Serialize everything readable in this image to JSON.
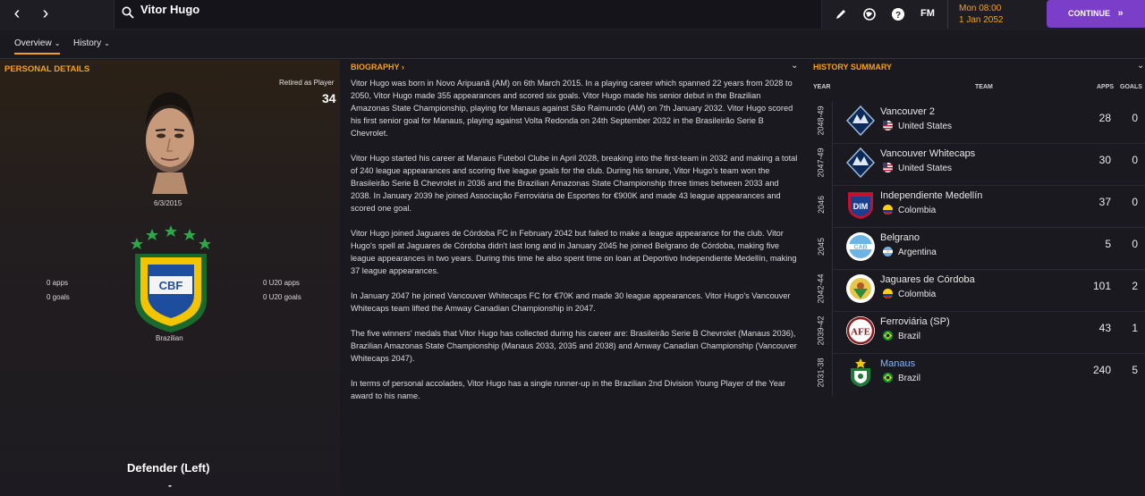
{
  "topbar": {
    "player_name": "Vitor Hugo",
    "time": "Mon 08:00",
    "date": "1 Jan 2052",
    "continue_label": "CONTINUE",
    "fm_label": "FM"
  },
  "tabs": [
    {
      "label": "Overview"
    },
    {
      "label": "History"
    }
  ],
  "personal": {
    "heading": "PERSONAL DETAILS",
    "retired_label": "Retired as Player",
    "retired_age": "34",
    "dob": "6/3/2015",
    "apps": "0 apps",
    "goals": "0 goals",
    "u20_apps": "0 U20 apps",
    "u20_goals": "0 U20 goals",
    "nationality": "Brazilian",
    "badge_text": "CBF",
    "position": "Defender (Left)",
    "position_sub": "-"
  },
  "bio": {
    "heading": "BIOGRAPHY",
    "paragraphs": [
      "Vitor Hugo was born in Novo Aripuanã (AM) on 6th March 2015. In a playing career which spanned 22 years from 2028 to 2050, Vitor Hugo made 355 appearances and scored six goals. Vitor Hugo made his senior debut in the Brazilian Amazonas State Championship, playing for Manaus against São Raimundo (AM) on 7th January 2032. Vitor Hugo scored his first senior goal for Manaus, playing against Volta Redonda on 24th September 2032 in the Brasileirão Serie B Chevrolet.",
      "Vitor Hugo started his career at Manaus Futebol Clube in April 2028, breaking into the first-team in 2032 and making a total of 240 league appearances and scoring five league goals for the club. During his tenure, Vitor Hugo's team won the Brasileirão Serie B Chevrolet in 2036 and the Brazilian Amazonas State Championship three times between 2033 and 2038. In January 2039 he joined Associação Ferroviária de Esportes for €900K and made 43 league appearances and scored one goal.",
      "Vitor Hugo joined Jaguares de Córdoba FC in February 2042 but failed to make a league appearance for the club. Vitor Hugo's spell at Jaguares de Córdoba didn't last long and in January 2045 he joined Belgrano de Córdoba, making five league appearances in two years. During this time he also spent time on loan at Deportivo Independiente Medellín, making 37 league appearances.",
      "In January 2047 he joined Vancouver Whitecaps FC for €70K and made 30 league appearances. Vitor Hugo's Vancouver Whitecaps team lifted the Amway Canadian Championship in 2047.",
      "The five winners' medals that Vitor Hugo has collected during his career are: Brasileirão Serie B Chevrolet (Manaus 2036), Brazilian Amazonas State Championship (Manaus 2033, 2035 and 2038) and Amway Canadian Championship (Vancouver Whitecaps 2047).",
      "In terms of personal accolades, Vitor Hugo has a single runner-up in the Brazilian 2nd Division Young Player of the Year award to his name."
    ]
  },
  "history": {
    "heading": "HISTORY SUMMARY",
    "col_year": "YEAR",
    "col_team": "TEAM",
    "col_apps": "APPS",
    "col_goals": "GOALS",
    "rows": [
      {
        "year": "2048-49",
        "team": "Vancouver 2",
        "nation": "United States",
        "apps": "28",
        "goals": "0",
        "crest": "vancouver",
        "color": "#1c3a6e"
      },
      {
        "year": "2047-49",
        "team": "Vancouver Whitecaps",
        "nation": "United States",
        "apps": "30",
        "goals": "0",
        "crest": "vancouver",
        "color": "#1c3a6e"
      },
      {
        "year": "2046",
        "team": "Independiente Medellín",
        "nation": "Colombia",
        "apps": "37",
        "goals": "0",
        "crest": "medellin",
        "color": "#c8102e"
      },
      {
        "year": "2045",
        "team": "Belgrano",
        "nation": "Argentina",
        "apps": "5",
        "goals": "0",
        "crest": "belgrano",
        "color": "#6cb4e4"
      },
      {
        "year": "2042-44",
        "team": "Jaguares de Córdoba",
        "nation": "Colombia",
        "apps": "101",
        "goals": "2",
        "crest": "jaguares",
        "color": "#2e8b3a"
      },
      {
        "year": "2039-42",
        "team": "Ferroviária (SP)",
        "nation": "Brazil",
        "apps": "43",
        "goals": "1",
        "crest": "ferroviaria",
        "color": "#8b1a1a"
      },
      {
        "year": "2031-38",
        "team": "Manaus",
        "nation": "Brazil",
        "apps": "240",
        "goals": "5",
        "crest": "manaus",
        "color": "#1f7a3a"
      }
    ]
  }
}
